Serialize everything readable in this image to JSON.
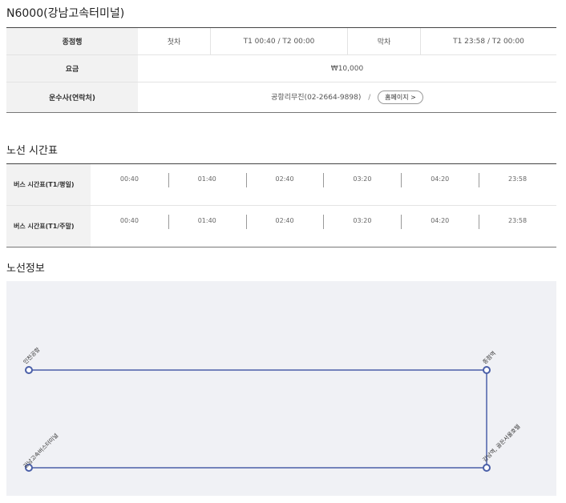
{
  "route_title": "N6000(강남고속터미널)",
  "info": {
    "terminus_label": "종점행",
    "first_label": "첫차",
    "first_value": "T1 00:40 / T2 00:00",
    "last_label": "막차",
    "last_value": "T1 23:58 / T2 00:00",
    "fare_label": "요금",
    "fare_value": "₩10,000",
    "operator_label": "운수사(연락처)",
    "operator_value": "공항리무진(02-2664-9898)",
    "separator": "/",
    "homepage_button": "홈페이지 >"
  },
  "schedule": {
    "title": "노선 시간표",
    "rows": [
      {
        "label": "버스 시간표(T1/평일)",
        "times": [
          "00:40",
          "01:40",
          "02:40",
          "03:20",
          "04:20",
          "23:58"
        ]
      },
      {
        "label": "버스 시간표(T1/주말)",
        "times": [
          "00:40",
          "01:40",
          "02:40",
          "03:20",
          "04:20",
          "23:58"
        ]
      }
    ]
  },
  "route_map": {
    "title": "노선정보",
    "line_color": "#4a5fa8",
    "stops": [
      "인천공항",
      "종점역",
      "강남역, 골든서울호텔",
      "강남고속버스터미널"
    ]
  }
}
